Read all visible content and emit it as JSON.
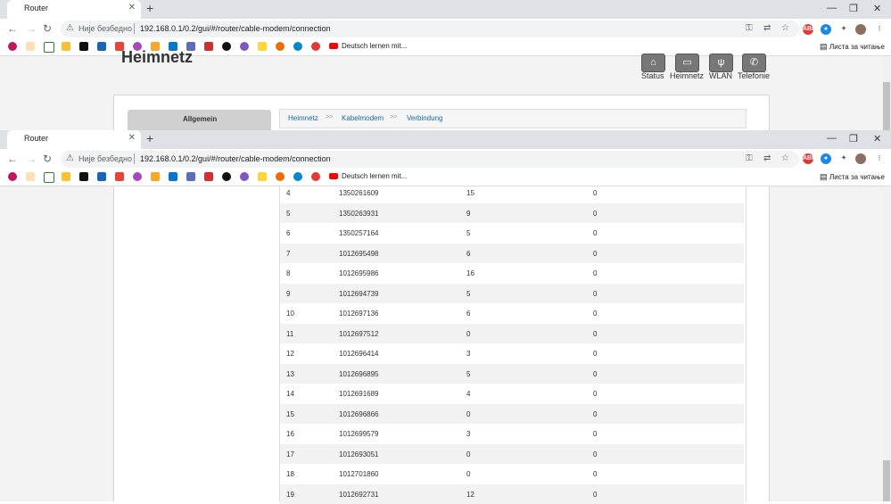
{
  "browser": {
    "tab_title": "Router",
    "close_glyph": "✕",
    "new_tab_glyph": "+",
    "security_label": "Није безбедно",
    "url": "192.168.0.1/0.2/gui/#/router/cable-modem/connection",
    "bookmark_last": "Deutsch lernen mit...",
    "reading_list": "Листа за читање"
  },
  "page": {
    "heading": "Heimnetz",
    "nav": [
      {
        "label": "Status",
        "icon": "home-icon"
      },
      {
        "label": "Heimnetz",
        "icon": "router-icon"
      },
      {
        "label": "WLAN",
        "icon": "wlan-icon"
      },
      {
        "label": "Telefonie",
        "icon": "phone-icon"
      }
    ],
    "left_menu": "Allgemein",
    "breadcrumb": [
      "Heimnetz",
      "Kabelmodem",
      "Verbindung"
    ],
    "breadcrumb_sep": ">>"
  },
  "table": {
    "rows": [
      [
        "4",
        "1350261609",
        "15",
        "0"
      ],
      [
        "5",
        "1350263931",
        "9",
        "0"
      ],
      [
        "6",
        "1350257164",
        "5",
        "0"
      ],
      [
        "7",
        "1012695498",
        "6",
        "0"
      ],
      [
        "8",
        "1012695986",
        "16",
        "0"
      ],
      [
        "9",
        "1012694739",
        "5",
        "0"
      ],
      [
        "10",
        "1012697136",
        "6",
        "0"
      ],
      [
        "11",
        "1012697512",
        "0",
        "0"
      ],
      [
        "12",
        "1012696414",
        "3",
        "0"
      ],
      [
        "13",
        "1012696895",
        "5",
        "0"
      ],
      [
        "14",
        "1012691689",
        "4",
        "0"
      ],
      [
        "15",
        "1012696866",
        "0",
        "0"
      ],
      [
        "16",
        "1012699579",
        "3",
        "0"
      ],
      [
        "17",
        "1012693051",
        "0",
        "0"
      ],
      [
        "18",
        "1012701860",
        "0",
        "0"
      ],
      [
        "19",
        "1012692731",
        "12",
        "0"
      ]
    ]
  },
  "colors": {
    "accent": "#1a6ba0",
    "row_alt": "#f2f2f2"
  }
}
